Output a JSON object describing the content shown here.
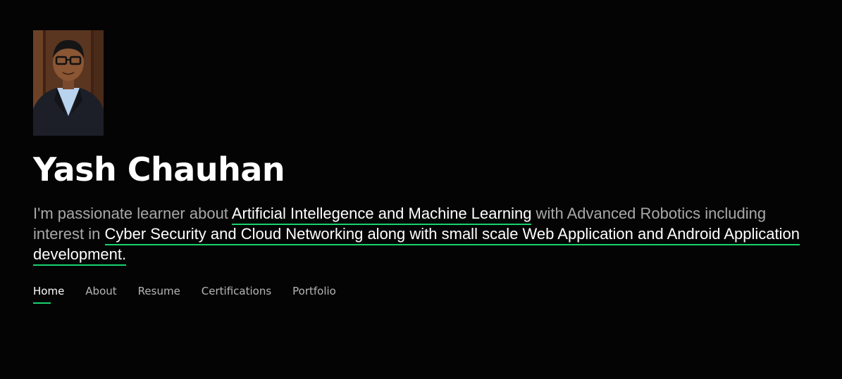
{
  "profile": {
    "name": "Yash Chauhan",
    "photo_alt": "profile-photo"
  },
  "intro": {
    "part1": "I'm passionate learner about ",
    "highlight1": "Artificial Intellegence and Machine Learning",
    "part2": " with Advanced Robotics including interest in ",
    "highlight2": "Cyber Security and Cloud Networking along with small scale Web Application and Android Application development."
  },
  "nav": {
    "items": [
      {
        "label": "Home",
        "active": true
      },
      {
        "label": "About",
        "active": false
      },
      {
        "label": "Resume",
        "active": false
      },
      {
        "label": "Certifications",
        "active": false
      },
      {
        "label": "Portfolio",
        "active": false
      }
    ]
  },
  "colors": {
    "background": "#040404",
    "accent": "#18d26e",
    "text": "#ffffff"
  }
}
